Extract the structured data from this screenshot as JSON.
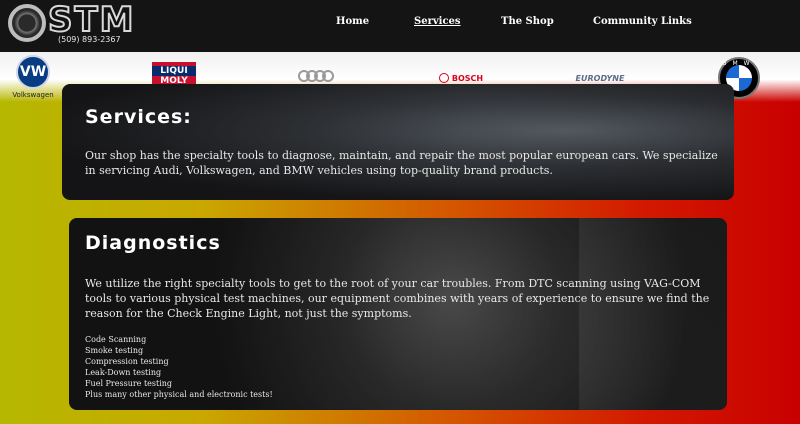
{
  "header": {
    "logo_text": "STM",
    "phone": "(509) 893-2367",
    "nav": [
      {
        "label": "Home",
        "active": false
      },
      {
        "label": "Services",
        "active": true
      },
      {
        "label": "The Shop",
        "active": false
      },
      {
        "label": "Community Links",
        "active": false
      }
    ]
  },
  "brands": {
    "vw_label": "Volkswagen",
    "vw_mark": "VW",
    "liquimoly_top": "LIQUI",
    "liquimoly_bottom": "MOLY",
    "bosch": "BOSCH",
    "eurodyne": "EURODYNE",
    "bmw": "BMW"
  },
  "services": {
    "title": "Services:",
    "body": "Our shop has the specialty tools to diagnose, maintain, and repair the most popular european cars. We specialize in servicing Audi, Volkswagen, and BMW vehicles using top-quality brand products."
  },
  "diagnostics": {
    "title": "Diagnostics",
    "body": "We utilize the right specialty tools to get to the root of your car troubles. From DTC scanning using VAG-COM tools to various physical test machines, our equipment combines with years of experience to ensure we find the reason for the Check Engine Light, not just the symptoms.",
    "list": [
      "Code Scanning",
      "Smoke testing",
      "Compression testing",
      "Leak-Down testing",
      "Fuel Pressure testing",
      "Plus many other physical and electronic tests!"
    ]
  },
  "colors": {
    "topbar": "#141414",
    "gradient_left": "#b5b800",
    "gradient_right": "#c80000"
  }
}
